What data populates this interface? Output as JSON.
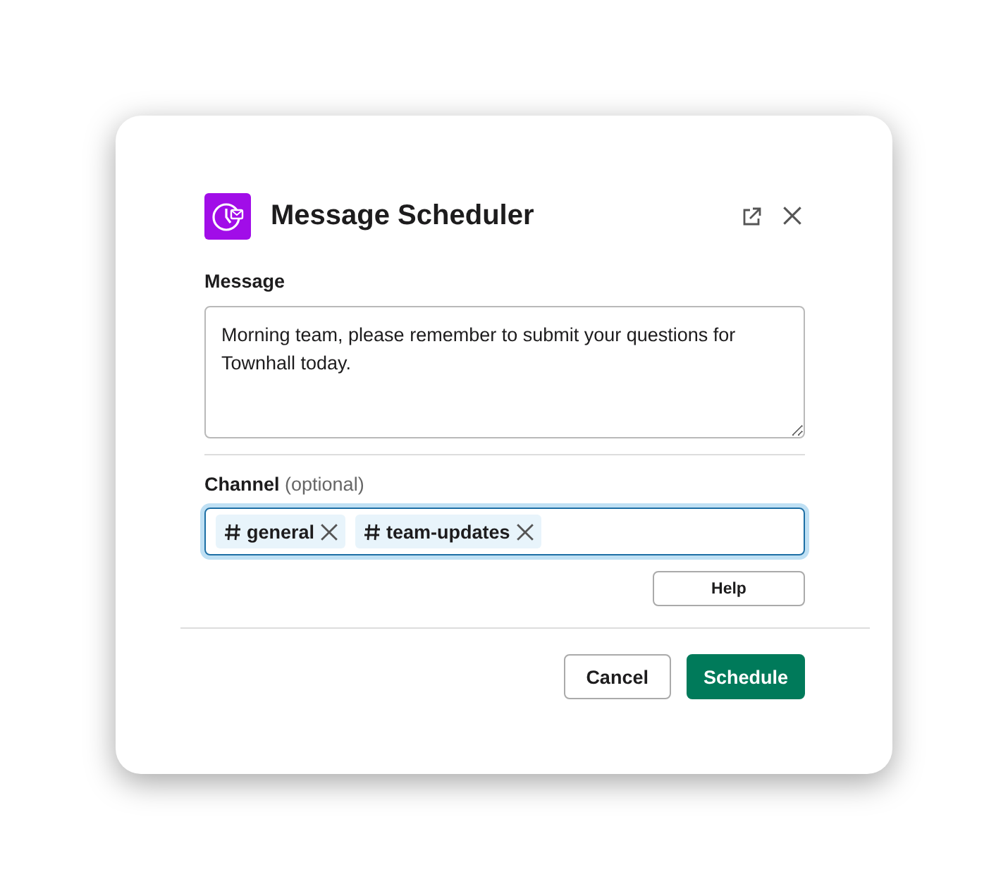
{
  "dialog": {
    "title": "Message Scheduler"
  },
  "message": {
    "label": "Message",
    "value": "Morning team, please remember to submit your questions for Townhall today."
  },
  "channel": {
    "label": "Channel",
    "hint": "(optional)",
    "focused": true,
    "tags": [
      {
        "label": "general"
      },
      {
        "label": "team-updates"
      }
    ]
  },
  "help_button": "Help",
  "buttons": [
    {
      "label": "Cancel",
      "kind": "secondary"
    },
    {
      "label": "Schedule",
      "kind": "primary"
    }
  ]
}
